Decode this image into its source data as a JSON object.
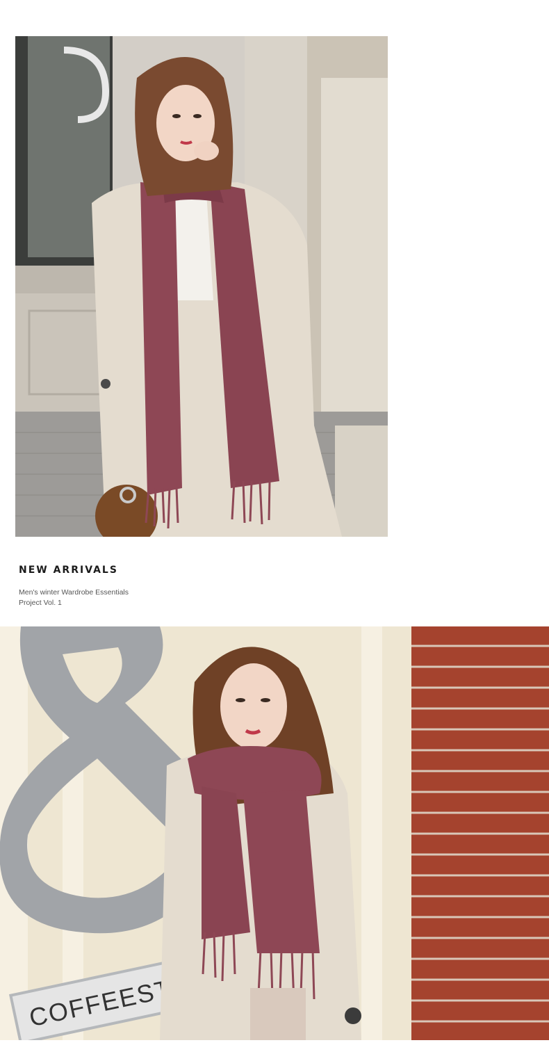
{
  "section": {
    "title": "NEW ARRIVALS",
    "subtitle_line1": "Men's winter Wardrobe Essentials",
    "subtitle_line2": "Project Vol. 1"
  },
  "photo2": {
    "sign_text": "COFFEEST"
  },
  "colors": {
    "scarf": "#8e4755",
    "coat": "#e4dccf",
    "brick": "#a5432e",
    "wall": "#eee6d2",
    "sign_gray": "#a1a4a8",
    "hair": "#7a4a30"
  }
}
